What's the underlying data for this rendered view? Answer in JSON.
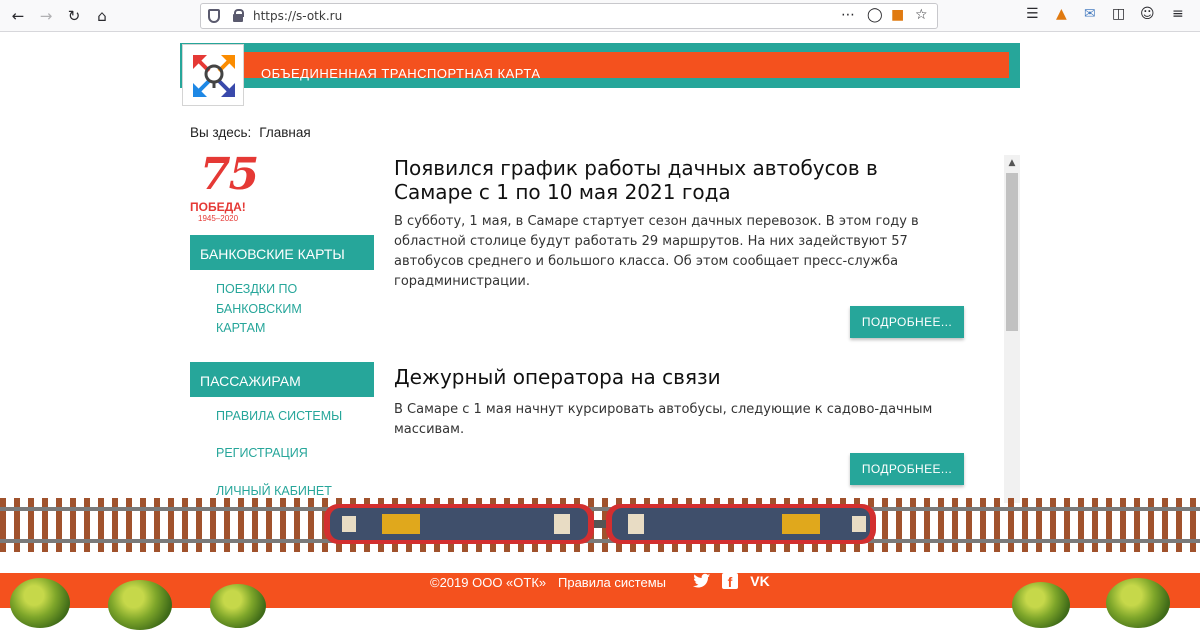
{
  "browser": {
    "url": "https://s-otk.ru"
  },
  "site": {
    "title": "ОБЪЕДИНЕННАЯ ТРАНСПОРТНАЯ КАРТА",
    "colors": {
      "teal": "#26a69a",
      "orange": "#f4511e"
    }
  },
  "breadcrumb": {
    "label": "Вы здесь:",
    "home": "Главная"
  },
  "badge": {
    "number": "75",
    "word": "ПОБЕДА!",
    "years": "1945–2020"
  },
  "sidebar": {
    "bank_cards": {
      "heading": "БАНКОВСКИЕ КАРТЫ",
      "links": [
        "ПОЕЗДКИ ПО",
        "БАНКОВСКИМ",
        "КАРТАМ"
      ]
    },
    "passengers": {
      "heading": "ПАССАЖИРАМ",
      "links": [
        "ПРАВИЛА СИСТЕМЫ",
        "РЕГИСТРАЦИЯ",
        "ЛИЧНЫЙ КАБИНЕТ"
      ]
    }
  },
  "posts": [
    {
      "title_line1": "Появился график работы дачных автобусов в",
      "title_line2": "Самаре с 1 по 10 мая 2021 года",
      "text_line1": "В субботу, 1 мая, в Самаре стартует сезон дачных перевозок. В этом году в",
      "text_line2": "областной столице будут работать 29 маршрутов. На них задействуют 57",
      "text_line3": "автобусов среднего и большого класса. Об этом сообщает пресс-служба",
      "text_line4": "горадминистрации.",
      "button": "ПОДРОБНЕЕ..."
    },
    {
      "title_line1": "Дежурный оператора на связи",
      "text_line1": "В Самаре с 1 мая начнут курсировать автобусы, следующие к садово-дачным",
      "text_line2": "массивам.",
      "button": "ПОДРОБНЕЕ..."
    }
  ],
  "footer": {
    "copyright": "©2019 ООО «ОТК»",
    "rules": "Правила системы",
    "social": [
      "twitter-icon",
      "facebook-icon",
      "vk-icon"
    ],
    "vk_label": "VK",
    "fb_label": "f"
  }
}
